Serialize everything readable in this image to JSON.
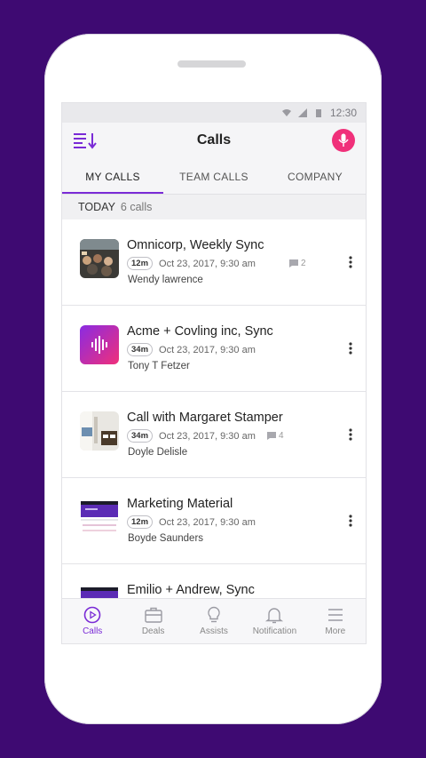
{
  "status_bar": {
    "time": "12:30"
  },
  "app_bar": {
    "title": "Calls"
  },
  "tabs": [
    {
      "label": "MY CALLS",
      "active": true
    },
    {
      "label": "TEAM CALLS",
      "active": false
    },
    {
      "label": "COMPANY",
      "active": false
    }
  ],
  "section": {
    "label": "TODAY",
    "count": "6 calls"
  },
  "calls": [
    {
      "title": "Omnicorp, Weekly Sync",
      "duration": "12m",
      "date": "Oct 23, 2017, 9:30 am",
      "comments": "2",
      "person": "Wendy lawrence",
      "thumb": "photo-meeting"
    },
    {
      "title": "Acme + Covling inc, Sync",
      "duration": "34m",
      "date": "Oct 23, 2017, 9:30 am",
      "comments": "",
      "person": "Tony T Fetzer",
      "thumb": "audio-wave"
    },
    {
      "title": "Call with Margaret Stamper",
      "duration": "34m",
      "date": "Oct 23, 2017, 9:30 am",
      "comments": "4",
      "person": "Doyle Delisle",
      "thumb": "photo-office"
    },
    {
      "title": "Marketing Material",
      "duration": "12m",
      "date": "Oct 23, 2017, 9:30 am",
      "comments": "",
      "person": "Boyde Saunders",
      "thumb": "screenshot"
    },
    {
      "title": "Emilio + Andrew, Sync",
      "duration": "",
      "date": "",
      "comments": "",
      "person": "",
      "thumb": "screenshot"
    }
  ],
  "bottom_nav": [
    {
      "label": "Calls",
      "icon": "play-circle-icon",
      "active": true
    },
    {
      "label": "Deals",
      "icon": "briefcase-icon",
      "active": false
    },
    {
      "label": "Assists",
      "icon": "bulb-icon",
      "active": false
    },
    {
      "label": "Notification",
      "icon": "bell-icon",
      "active": false
    },
    {
      "label": "More",
      "icon": "hamburger-icon",
      "active": false
    }
  ],
  "colors": {
    "background": "#3e0a72",
    "accent": "#7a2bd6",
    "mic": "#f0307a"
  }
}
